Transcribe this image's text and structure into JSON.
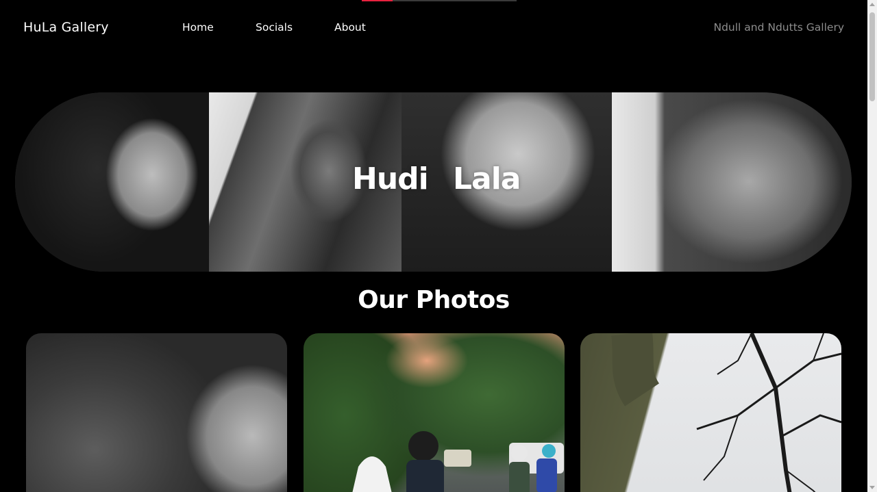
{
  "progress": {
    "fraction": 0.2
  },
  "header": {
    "brand": "HuLa Gallery",
    "nav": [
      {
        "label": "Home"
      },
      {
        "label": "Socials"
      },
      {
        "label": "About"
      }
    ],
    "tagline": "Ndull and Ndutts Gallery"
  },
  "hero": {
    "names": [
      "Hudi",
      "Lala"
    ],
    "photos": [
      "portrait-1",
      "portrait-2",
      "portrait-3",
      "portrait-4"
    ]
  },
  "gallery": {
    "title": "Our Photos",
    "photos": [
      "photo-selfie-bw",
      "photo-street-motorbikes",
      "photo-tree-branches"
    ]
  },
  "colors": {
    "background": "#000000",
    "accent": "#e8213f",
    "tagline": "#8d8d8d"
  }
}
